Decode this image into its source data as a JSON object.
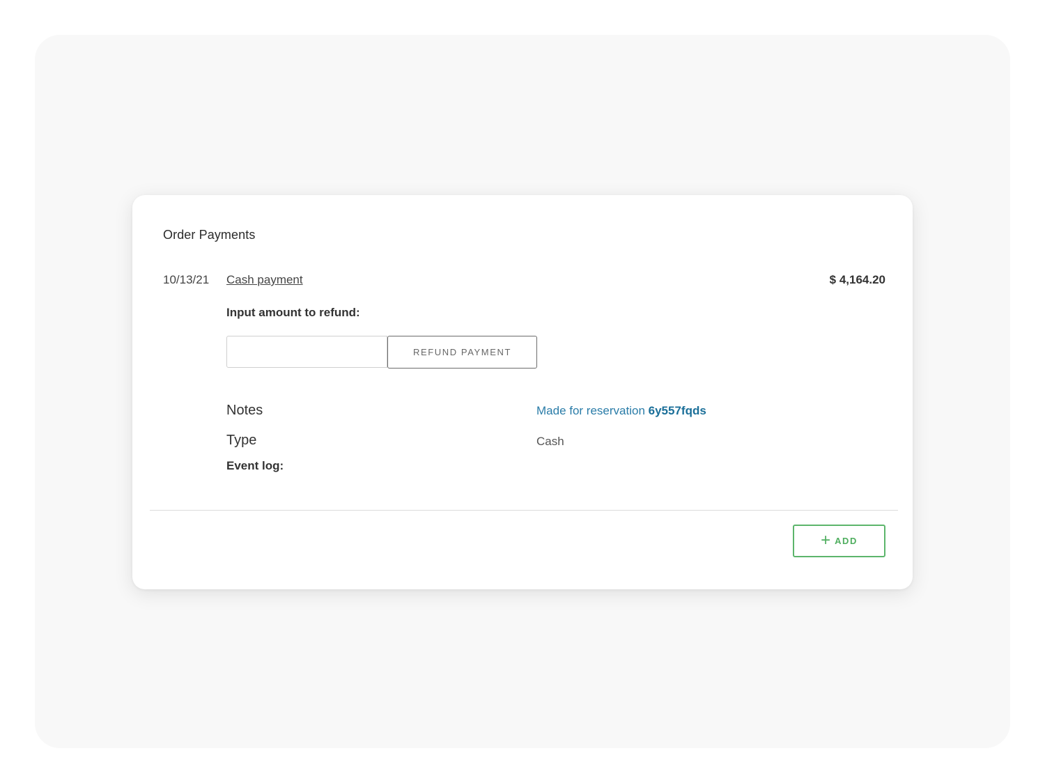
{
  "card": {
    "title": "Order Payments"
  },
  "payment": {
    "date": "10/13/21",
    "method_link": "Cash payment",
    "amount": "$ 4,164.20"
  },
  "refund": {
    "label": "Input amount to refund:",
    "input_value": "",
    "input_placeholder": "",
    "button_label": "REFUND PAYMENT"
  },
  "details": {
    "notes_label": "Notes",
    "notes_prefix": "Made for reservation",
    "reservation_id": "6y557fqds",
    "type_label": "Type",
    "type_value": "Cash",
    "event_log_label": "Event log:"
  },
  "footer": {
    "add_icon": "plus-icon",
    "add_label": "ADD"
  },
  "colors": {
    "link_blue": "#2a7ca8",
    "reservation_blue": "#1b6f99",
    "add_green": "#4fae5f",
    "backdrop": "#f8f8f8"
  }
}
